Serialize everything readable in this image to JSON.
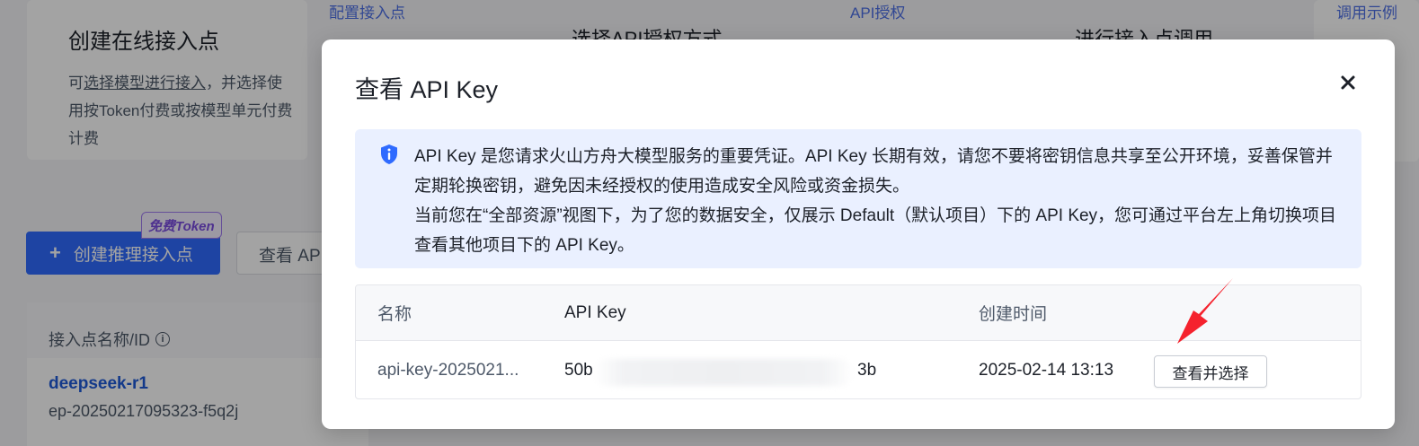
{
  "background": {
    "steps": [
      {
        "label": "配置接入点",
        "title": "选择API授权方式"
      },
      {
        "label": "API授权",
        "title": "进行接入点调用"
      },
      {
        "label": "调用示例"
      }
    ],
    "info_card": {
      "title": "创建在线接入点",
      "text_prefix": "可",
      "text_link": "选择模型进行接入",
      "text_suffix": "，并选择使用按Token付费或按模型单元付费计费"
    },
    "create_button_label": "创建推理接入点",
    "token_badge": "免费Token",
    "view_button_label": "查看 API Key",
    "list": {
      "column_header": "接入点名称/ID",
      "row_name": "deepseek-r1",
      "row_id": "ep-20250217095323-f5q2j"
    }
  },
  "modal": {
    "title": "查看 API Key",
    "close_icon": "close-icon",
    "alert": {
      "icon": "shield-info-icon",
      "line1": "API Key 是您请求火山方舟大模型服务的重要凭证。API Key 长期有效，请您不要将密钥信息共享至公开环境，妥善保管并定期轮换密钥，避免因未经授权的使用造成安全风险或资金损失。",
      "line2": "当前您在“全部资源”视图下，为了您的数据安全，仅展示 Default（默认项目）下的 API Key，您可通过平台左上角切换项目查看其他项目下的 API Key。"
    },
    "table": {
      "headers": [
        "名称",
        "API Key",
        "创建时间"
      ],
      "rows": [
        {
          "name": "api-key-2025021...",
          "key_start": "50b",
          "key_end": "3b",
          "created": "2025-02-14 13:13",
          "action": "查看并选择"
        }
      ]
    }
  },
  "colors": {
    "primary": "#2f6bff",
    "link": "#1e5ad8",
    "alert_bg": "#eaf0ff",
    "arrow": "#f5222d"
  }
}
